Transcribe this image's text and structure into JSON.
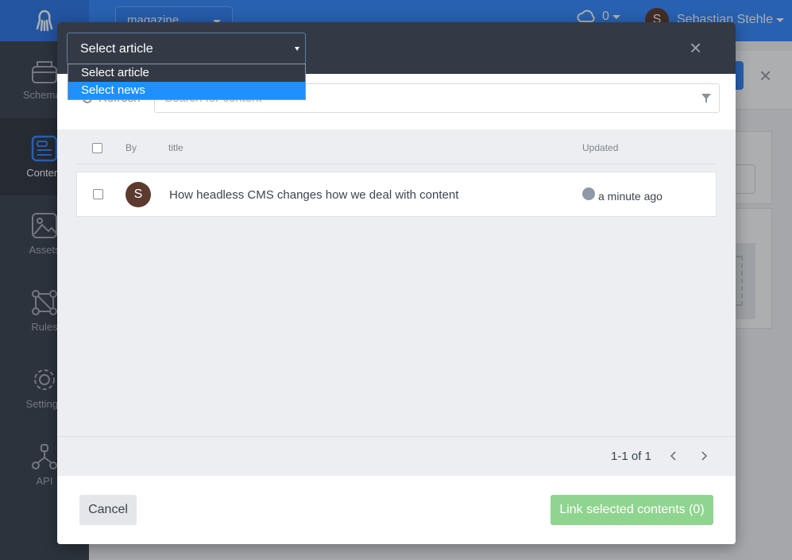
{
  "app": {
    "selected_app": "magazine",
    "notification_count": "0",
    "user_name": "Sebastian Stehle",
    "user_initial": "S"
  },
  "sidebar": {
    "items": [
      {
        "label": "Schemas",
        "icon": "schema-icon"
      },
      {
        "label": "Content",
        "icon": "content-icon",
        "active": true
      },
      {
        "label": "Assets",
        "icon": "image-icon"
      },
      {
        "label": "Rules",
        "icon": "rules-icon"
      },
      {
        "label": "Settings",
        "icon": "gear-icon"
      },
      {
        "label": "API",
        "icon": "api-icon"
      }
    ]
  },
  "modal": {
    "schema_select": {
      "value": "Select article",
      "options": [
        "Select article",
        "Select news"
      ],
      "highlighted": "Select news"
    },
    "toolbar": {
      "refresh_label": "Refresh",
      "search_placeholder": "Search for content"
    },
    "table": {
      "columns": {
        "by": "By",
        "title": "title",
        "updated": "Updated"
      },
      "rows": [
        {
          "author_initial": "S",
          "title": "How headless CMS changes how we deal with content",
          "updated": "a minute ago"
        }
      ]
    },
    "pager": {
      "text": "1-1 of 1"
    },
    "footer": {
      "cancel_label": "Cancel",
      "link_label": "Link selected contents (0)"
    }
  },
  "colors": {
    "accent": "#3389ff",
    "sidebar": "#3a424e",
    "modal_header": "#333a45",
    "link_button": "#8fd48f",
    "dropdown_highlight": "#1e90ff"
  }
}
